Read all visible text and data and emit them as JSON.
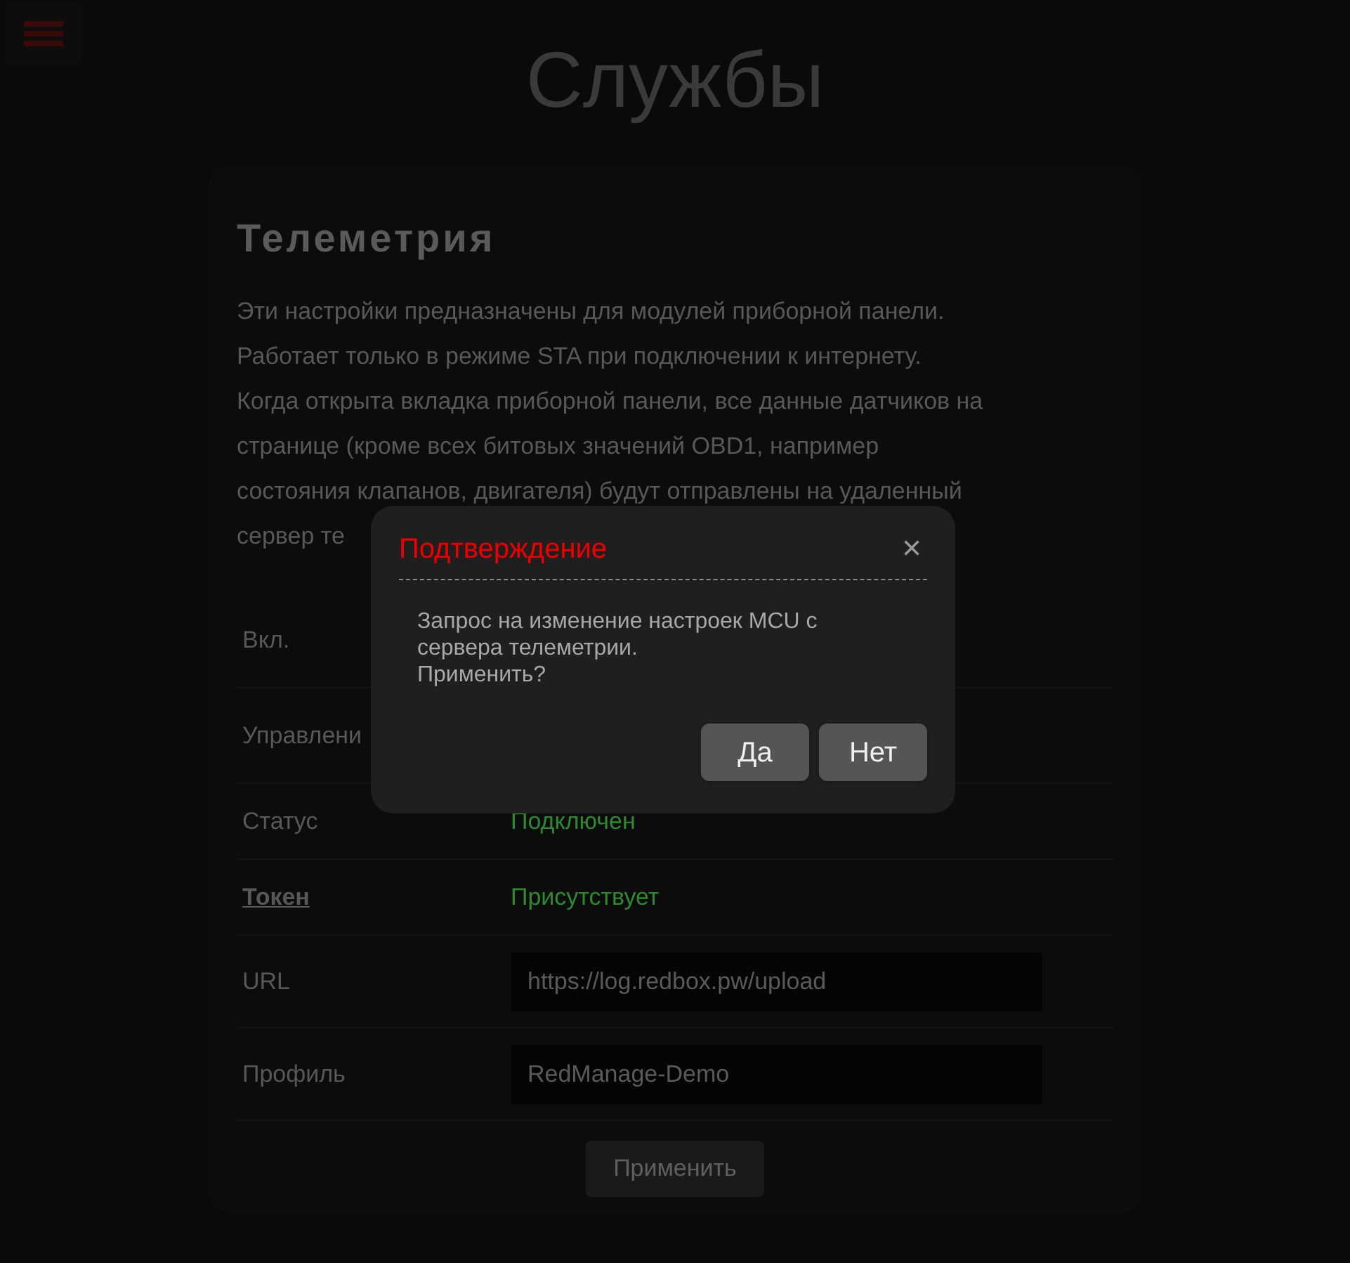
{
  "page": {
    "title": "Службы"
  },
  "card": {
    "title": "Телеметрия",
    "description_lines": [
      "Эти настройки предназначены для модулей приборной панели.",
      "Работает только в режиме STA при подключении к интернету.",
      "Когда открыта вкладка приборной панели, все данные датчиков на",
      "странице (кроме всех битовых значений OBD1, например",
      "состояния клапанов, двигателя) будут отправлены на удаленный",
      "сервер те"
    ],
    "rows": [
      {
        "label": "Вкл.",
        "link": false,
        "kind": "empty"
      },
      {
        "label": "Управлени",
        "link": false,
        "kind": "empty"
      },
      {
        "label": "Статус",
        "link": false,
        "kind": "status",
        "value": "Подключен"
      },
      {
        "label": "Токен",
        "link": true,
        "kind": "status",
        "value": "Присутствует"
      },
      {
        "label": "URL",
        "link": false,
        "kind": "input",
        "value": "https://log.redbox.pw/upload"
      },
      {
        "label": "Профиль",
        "link": false,
        "kind": "input",
        "value": "RedManage-Demo"
      }
    ],
    "apply_button": "Применить"
  },
  "dialog": {
    "title": "Подтверждение",
    "close": "×",
    "message_lines": [
      "Запрос на изменение настроек MCU с",
      "сервера телеметрии.",
      "Применить?"
    ],
    "buttons": [
      "Да",
      "Нет"
    ]
  }
}
